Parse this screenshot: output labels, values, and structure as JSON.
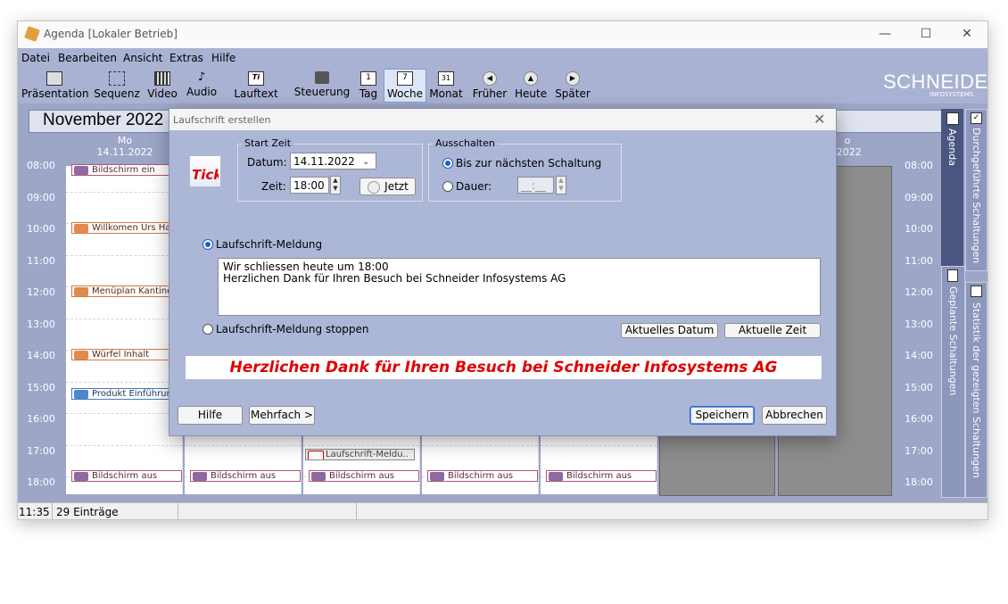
{
  "window": {
    "title": "Agenda [Lokaler Betrieb]",
    "minimize": "—",
    "maximize": "☐",
    "close": "✕"
  },
  "menu": [
    "Datei",
    "Bearbeiten",
    "Ansicht",
    "Extras",
    "Hilfe"
  ],
  "toolbar": [
    {
      "label": "Präsentation",
      "icon": "presentation-icon"
    },
    {
      "label": "Sequenz",
      "icon": "sequence-icon"
    },
    {
      "label": "Video",
      "icon": "video-icon"
    },
    {
      "label": "Audio",
      "icon": "audio-icon"
    },
    {
      "label": "Lauftext",
      "icon": "ticker-icon"
    },
    {
      "label": "Steuerung",
      "icon": "control-icon"
    },
    {
      "label": "Tag",
      "icon": "day-calendar-icon",
      "glyph": "1"
    },
    {
      "label": "Woche",
      "icon": "week-calendar-icon",
      "glyph": "7"
    },
    {
      "label": "Monat",
      "icon": "month-calendar-icon",
      "glyph": "31"
    },
    {
      "label": "Früher",
      "icon": "arrow-left-icon"
    },
    {
      "label": "Heute",
      "icon": "arrow-up-icon"
    },
    {
      "label": "Später",
      "icon": "arrow-right-icon"
    }
  ],
  "logo": {
    "main": "SCHNEIDER",
    "sub": "INFOSYSTEMS"
  },
  "calendar": {
    "month": "November 2022",
    "times": [
      "08:00",
      "09:00",
      "10:00",
      "11:00",
      "12:00",
      "13:00",
      "14:00",
      "15:00",
      "16:00",
      "17:00",
      "18:00"
    ],
    "first_day": {
      "name": "Mo",
      "date": "14.11.2022"
    },
    "last_day": {
      "name": "o",
      "date": ".2022"
    },
    "events": {
      "e1": "Bildschirm ein",
      "e2": "Willkomen Urs Ha",
      "e3": "Menüplan Kantine",
      "e4": "Würfel Inhalt",
      "e5": "Produkt Einführun",
      "e6": "Laufschrift-Meldu..",
      "off": "Bildschirm aus"
    }
  },
  "side_tabs": {
    "agenda": "Agenda",
    "done": "Durchgeführte Schaltungen",
    "planned": "Geplante Schaltungen",
    "stats": "Statistik der gezeigten Schaltungen"
  },
  "status": {
    "time": "11:35",
    "entries": "29 Einträge"
  },
  "dialog": {
    "title": "Laufschrift erstellen",
    "close": "✕",
    "icon_text": "Tick",
    "start_group": "Start Zeit",
    "date_label": "Datum:",
    "date_value": "14.11.2022",
    "time_label": "Zeit:",
    "time_value": "18:00",
    "now_button": "Jetzt",
    "off_group": "Ausschalten",
    "until_next": "Bis zur nächsten Schaltung",
    "duration_label": "Dauer:",
    "duration_value": "__:__",
    "msg_option": "Laufschrift-Meldung",
    "msg_line1": "Wir schliessen heute um 18:00",
    "msg_line2": "Herzlichen Dank für Ihren Besuch bei Schneider Infosystems AG",
    "stop_option": "Laufschrift-Meldung stoppen",
    "current_date_btn": "Aktuelles Datum",
    "current_time_btn": "Aktuelle Zeit",
    "preview": "Herzlichen Dank für Ihren Besuch bei Schneider Infosystems AG",
    "help_btn": "Hilfe",
    "multi_btn": "Mehrfach >",
    "save_btn": "Speichern",
    "cancel_btn": "Abbrechen"
  }
}
